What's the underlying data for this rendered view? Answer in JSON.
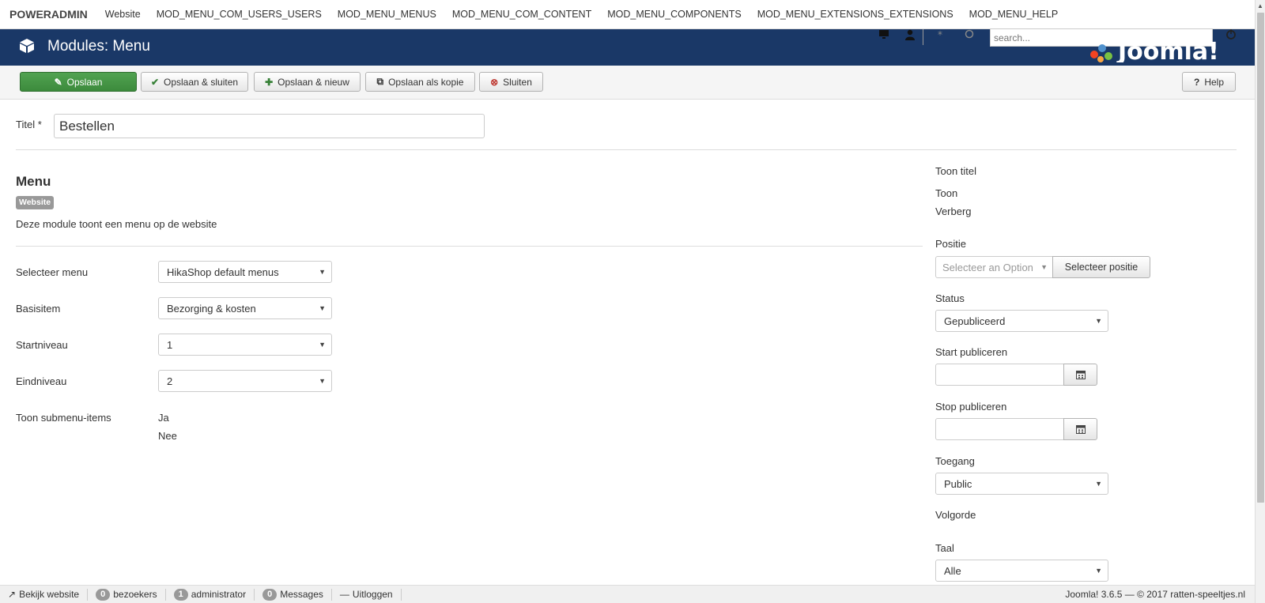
{
  "topnav": {
    "brand": "POWERADMIN",
    "items": [
      "Website",
      "MOD_MENU_COM_USERS_USERS",
      "MOD_MENU_MENUS",
      "MOD_MENU_COM_CONTENT",
      "MOD_MENU_COMPONENTS",
      "MOD_MENU_EXTENSIONS_EXTENSIONS",
      "MOD_MENU_HELP"
    ]
  },
  "header": {
    "title": "Modules: Menu",
    "search_placeholder": "search...",
    "background": "#1a3867"
  },
  "toolbar": {
    "save": "Opslaan",
    "save_close": "Opslaan & sluiten",
    "save_new": "Opslaan & nieuw",
    "save_copy": "Opslaan als kopie",
    "close": "Sluiten",
    "help": "Help",
    "success_color": "#46a046"
  },
  "form": {
    "title_label": "Titel *",
    "title_value": "Bestellen",
    "module_name": "Menu",
    "badge": "Website",
    "description": "Deze module toont een menu op de website",
    "fields": {
      "select_menu_label": "Selecteer menu",
      "select_menu_value": "HikaShop default menus",
      "base_item_label": "Basisitem",
      "base_item_value": "Bezorging & kosten",
      "start_level_label": "Startniveau",
      "start_level_value": "1",
      "end_level_label": "Eindniveau",
      "end_level_value": "2",
      "show_submenu_label": "Toon submenu-items",
      "show_submenu_yes": "Ja",
      "show_submenu_no": "Nee"
    }
  },
  "sidebar": {
    "show_title_label": "Toon titel",
    "show_title_show": "Toon",
    "show_title_hide": "Verberg",
    "position_label": "Positie",
    "position_placeholder": "Selecteer an Option",
    "position_button": "Selecteer positie",
    "status_label": "Status",
    "status_value": "Gepubliceerd",
    "start_publish_label": "Start publiceren",
    "stop_publish_label": "Stop publiceren",
    "access_label": "Toegang",
    "access_value": "Public",
    "ordering_label": "Volgorde",
    "language_label": "Taal",
    "language_value": "Alle"
  },
  "footer": {
    "view_site": "Bekijk website",
    "visitors_count": "0",
    "visitors_label": "bezoekers",
    "admins_count": "1",
    "admins_label": "administrator",
    "messages_count": "0",
    "messages_label": "Messages",
    "logout": "Uitloggen",
    "copyright": "Joomla! 3.6.5 — © 2017 ratten-speeltjes.nl"
  }
}
